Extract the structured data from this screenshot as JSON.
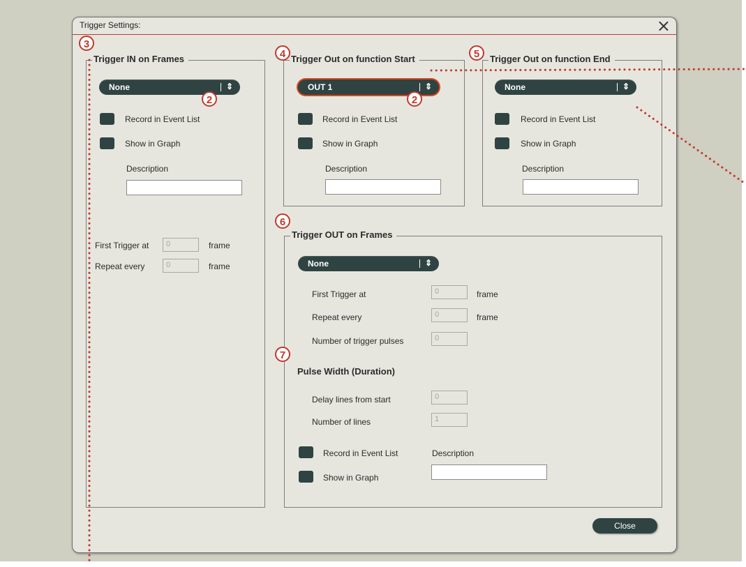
{
  "dialog": {
    "title": "Trigger Settings:",
    "close_icon": "×",
    "close_button": "Close"
  },
  "trigger_in": {
    "legend": "Trigger IN on Frames",
    "dropdown": "None",
    "record_label": "Record in Event List",
    "show_label": "Show in Graph",
    "description_label": "Description",
    "first_trigger_label": "First Trigger at",
    "first_trigger_value": "0",
    "first_trigger_unit": "frame",
    "repeat_label": "Repeat every",
    "repeat_value": "0",
    "repeat_unit": "frame"
  },
  "trigger_out_start": {
    "legend": "Trigger Out on function Start",
    "dropdown": "OUT 1",
    "record_label": "Record in Event List",
    "show_label": "Show in Graph",
    "description_label": "Description"
  },
  "trigger_out_end": {
    "legend": "Trigger Out on function End",
    "dropdown": "None",
    "record_label": "Record in Event List",
    "show_label": "Show in Graph",
    "description_label": "Description"
  },
  "trigger_out_frames": {
    "legend": "Trigger OUT on Frames",
    "dropdown": "None",
    "first_trigger_label": "First Trigger at",
    "first_trigger_value": "0",
    "first_trigger_unit": "frame",
    "repeat_label": "Repeat every",
    "repeat_value": "0",
    "repeat_unit": "frame",
    "pulses_label": "Number of trigger pulses",
    "pulses_value": "0",
    "pulse_width_title": "Pulse Width (Duration)",
    "delay_label": "Delay lines from start",
    "delay_value": "0",
    "lines_label": "Number of lines",
    "lines_value": "1",
    "record_label": "Record in Event List",
    "show_label": "Show in Graph",
    "description_label": "Description"
  },
  "callouts": {
    "c2a": "2",
    "c2b": "2",
    "c3": "3",
    "c4": "4",
    "c5": "5",
    "c6": "6",
    "c7": "7"
  },
  "colors": {
    "accent": "#c0392b",
    "control": "#2f4342",
    "dialog_bg": "#e6e6df",
    "backdrop": "#cfcfc2"
  }
}
